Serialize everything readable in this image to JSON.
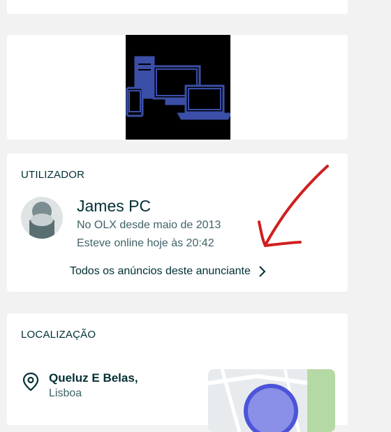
{
  "user_section": {
    "title": "UTILIZADOR",
    "name": "James PC",
    "member_since": "No OLX desde maio de 2013",
    "last_online": "Esteve online hoje às 20:42",
    "all_ads_link": "Todos os anúncios deste anunciante"
  },
  "location_section": {
    "title": "LOCALIZAÇÃO",
    "city": "Queluz E Belas,",
    "region": "Lisboa"
  },
  "ad_image": {
    "icon": "computer-devices-icon",
    "color": "#3b4fa8"
  },
  "annotation": {
    "color": "#d11f1f"
  },
  "colors": {
    "background": "#f2f2f2",
    "card": "#ffffff",
    "text": "#002f34",
    "muted": "#406367"
  }
}
